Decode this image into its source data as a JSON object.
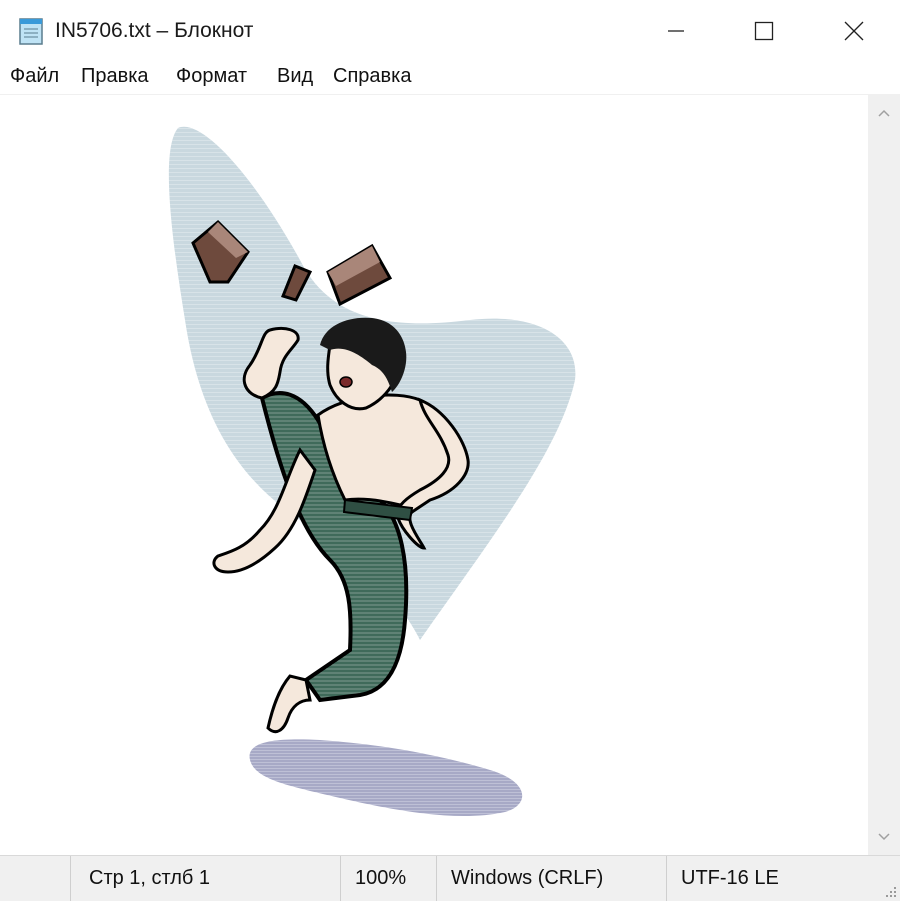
{
  "window": {
    "title": "IN5706.txt – Блокнот",
    "icons": {
      "app": "notepad-icon",
      "minimize": "minimize-icon",
      "maximize": "maximize-icon",
      "close": "close-icon"
    }
  },
  "menu": {
    "items": [
      "Файл",
      "Правка",
      "Формат",
      "Вид",
      "Справка"
    ]
  },
  "content": {
    "image": "clipart-martial-artist-kicking-board",
    "colors": {
      "background_spot": "#c9d8df",
      "pants": "#3f6a5a",
      "skin": "#f5e8dc",
      "board": "#6e4a3d",
      "shadow": "#a7a9c6"
    }
  },
  "scrollbar": {
    "up_icon": "scroll-up-icon",
    "down_icon": "scroll-down-icon"
  },
  "status": {
    "position": "Стр 1, стлб 1",
    "zoom": "100%",
    "line_endings": "Windows (CRLF)",
    "encoding": "UTF-16 LE"
  }
}
